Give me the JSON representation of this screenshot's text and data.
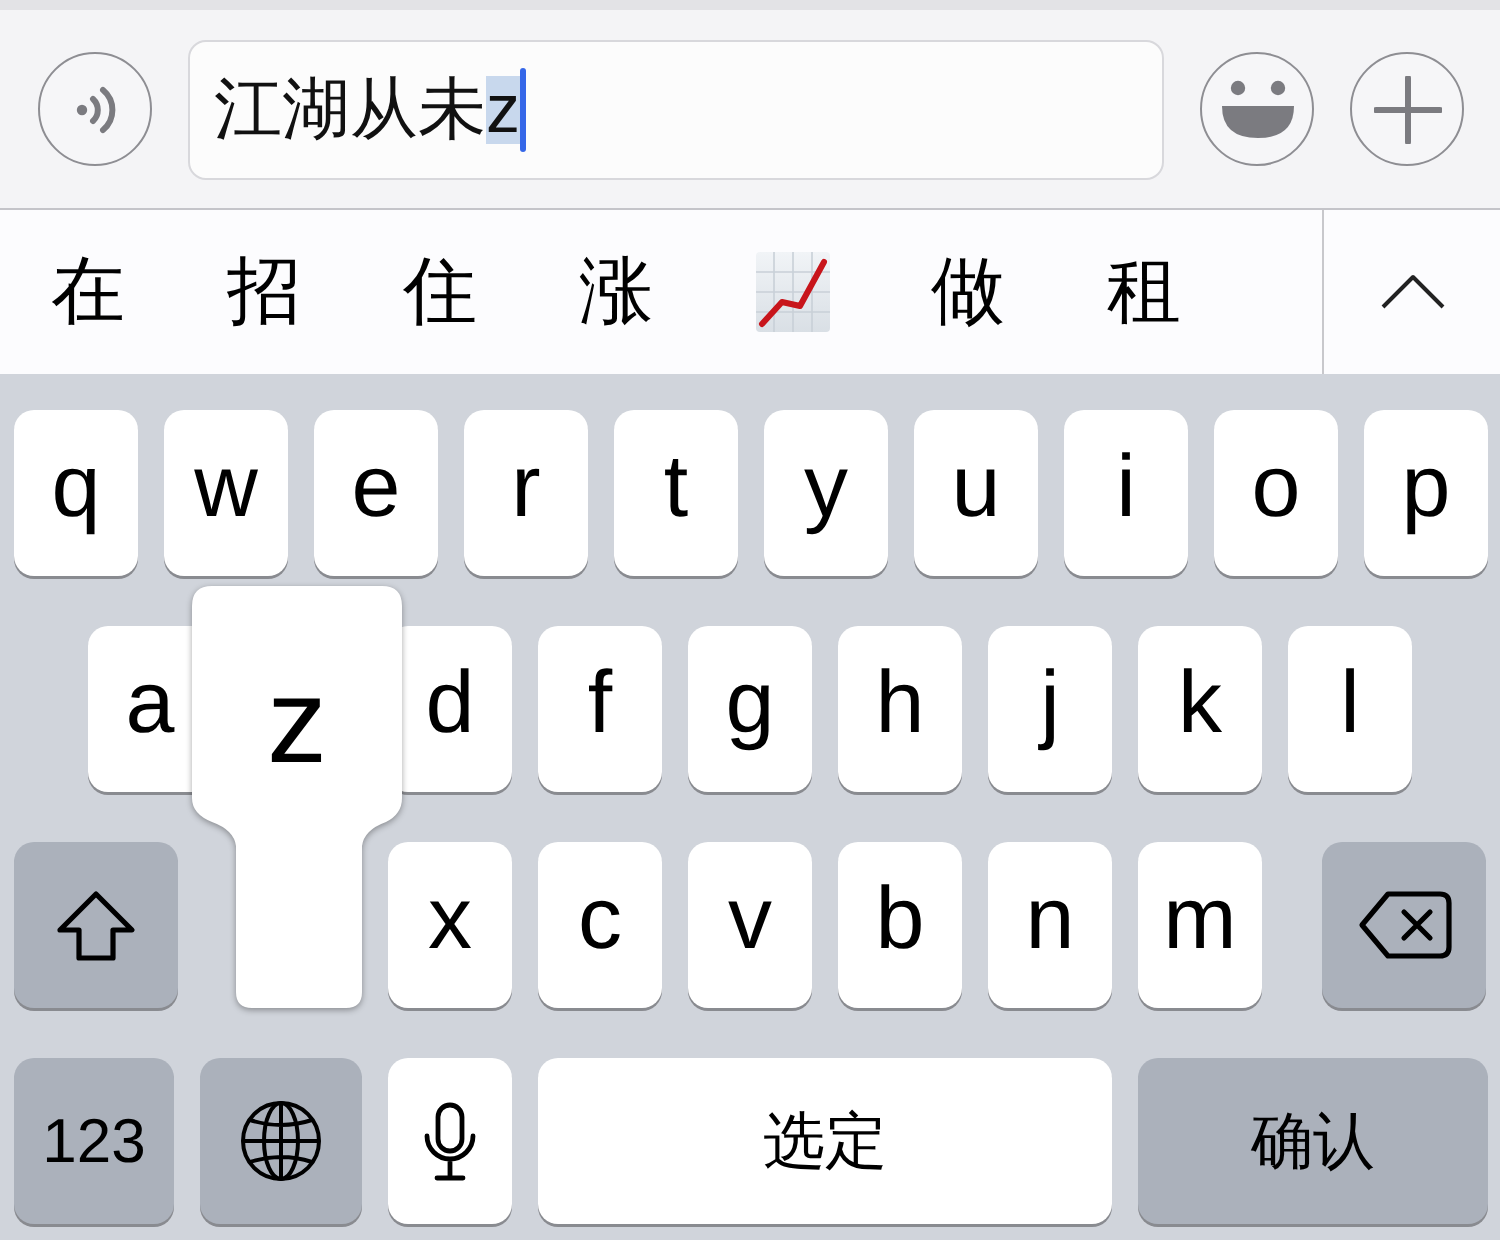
{
  "input_bar": {
    "message_field": {
      "value": "江湖从未",
      "marked_text": "z",
      "focused": true
    }
  },
  "candidates": [
    {
      "kind": "text",
      "text": "在"
    },
    {
      "kind": "text",
      "text": "招"
    },
    {
      "kind": "text",
      "text": "住"
    },
    {
      "kind": "text",
      "text": "涨"
    },
    {
      "kind": "emoji"
    },
    {
      "kind": "text",
      "text": "做"
    },
    {
      "kind": "text",
      "text": "租"
    }
  ],
  "keyboard": {
    "key_preview": {
      "label": "z"
    },
    "rows": [
      [
        {
          "kind": "letter",
          "label": "q",
          "pressed": false
        },
        {
          "kind": "letter",
          "label": "w",
          "pressed": false
        },
        {
          "kind": "letter",
          "label": "e",
          "pressed": false
        },
        {
          "kind": "letter",
          "label": "r",
          "pressed": false
        },
        {
          "kind": "letter",
          "label": "t",
          "pressed": false
        },
        {
          "kind": "letter",
          "label": "y",
          "pressed": false
        },
        {
          "kind": "letter",
          "label": "u",
          "pressed": false
        },
        {
          "kind": "letter",
          "label": "i",
          "pressed": false
        },
        {
          "kind": "letter",
          "label": "o",
          "pressed": false
        },
        {
          "kind": "letter",
          "label": "p",
          "pressed": false
        }
      ],
      [
        {
          "kind": "letter",
          "label": "a",
          "pressed": false
        },
        {
          "kind": "letter",
          "label": "d",
          "pressed": false
        },
        {
          "kind": "letter",
          "label": "f",
          "pressed": false
        },
        {
          "kind": "letter",
          "label": "g",
          "pressed": false
        },
        {
          "kind": "letter",
          "label": "h",
          "pressed": false
        },
        {
          "kind": "letter",
          "label": "j",
          "pressed": false
        },
        {
          "kind": "letter",
          "label": "k",
          "pressed": false
        },
        {
          "kind": "letter",
          "label": "l",
          "pressed": false
        }
      ],
      [
        {
          "kind": "shift",
          "pressed": false
        },
        {
          "kind": "letter",
          "pressed": true
        },
        {
          "kind": "letter",
          "label": "x",
          "pressed": false
        },
        {
          "kind": "letter",
          "label": "c",
          "pressed": false
        },
        {
          "kind": "letter",
          "label": "v",
          "pressed": false
        },
        {
          "kind": "letter",
          "label": "b",
          "pressed": false
        },
        {
          "kind": "letter",
          "label": "n",
          "pressed": false
        },
        {
          "kind": "letter",
          "label": "m",
          "pressed": false
        },
        {
          "kind": "delete",
          "pressed": false
        }
      ]
    ],
    "bottom_row": [
      {
        "kind": "numbers",
        "label": "123",
        "pressed": false
      },
      {
        "kind": "globe",
        "pressed": false
      },
      {
        "kind": "mic",
        "pressed": false
      },
      {
        "kind": "space",
        "label": "选定",
        "pressed": false
      },
      {
        "kind": "return",
        "label": "确认",
        "pressed": false
      }
    ]
  }
}
